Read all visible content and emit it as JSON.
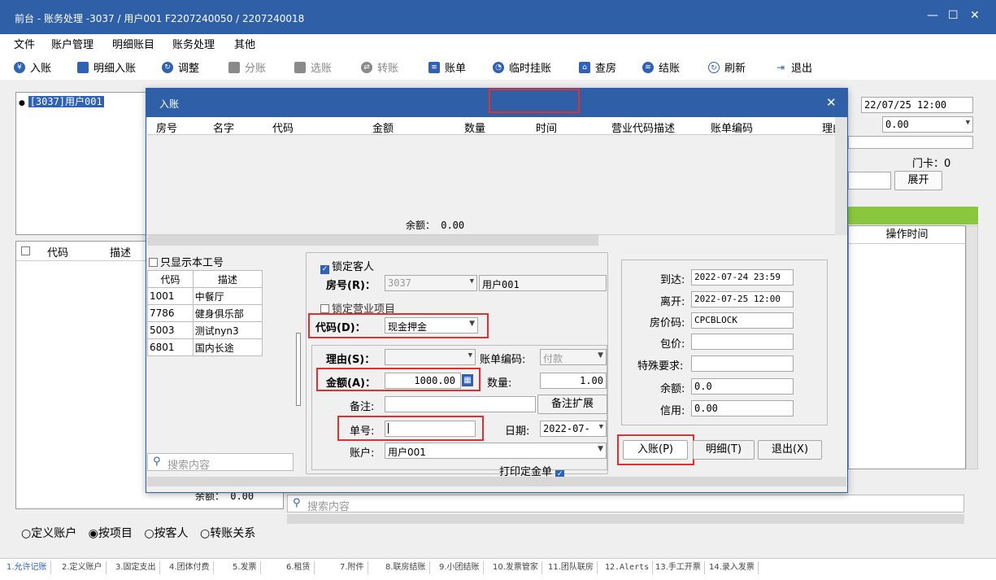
{
  "window": {
    "title": "前台 - 账务处理 -3037 / 用户001 F2207240050 / 2207240018",
    "controls": [
      "—",
      "☐",
      "✕"
    ]
  },
  "menu": [
    "文件",
    "账户管理",
    "明细账目",
    "账务处理",
    "其他"
  ],
  "toolbar": [
    {
      "label": "入账",
      "icon": "coin-icon",
      "disabled": false
    },
    {
      "label": "明细入账",
      "icon": "card-icon",
      "disabled": false
    },
    {
      "label": "调整",
      "icon": "adjust-icon",
      "disabled": false
    },
    {
      "label": "分账",
      "icon": "split-icon",
      "disabled": true
    },
    {
      "label": "选账",
      "icon": "select-icon",
      "disabled": true
    },
    {
      "label": "转账",
      "icon": "transfer-icon",
      "disabled": true
    },
    {
      "label": "账单",
      "icon": "bill-icon",
      "disabled": false
    },
    {
      "label": "临时挂账",
      "icon": "clock-icon",
      "disabled": false
    },
    {
      "label": "查房",
      "icon": "house-icon",
      "disabled": false
    },
    {
      "label": "结账",
      "icon": "stack-icon",
      "disabled": false
    },
    {
      "label": "刷新",
      "icon": "refresh-icon",
      "disabled": false
    },
    {
      "label": "退出",
      "icon": "exit-icon",
      "disabled": false
    }
  ],
  "background": {
    "tree_item": "[3037]用户001",
    "date_value": "22/07/25 12:00",
    "amount_value": "0.00",
    "door_card": "门卡：0",
    "expand_button": "展开",
    "op_time_header": "操作时间",
    "left_grid_headers": [
      "代码",
      "描述"
    ],
    "balance": "余额： 0.00",
    "radios": [
      "定义账户",
      "按项目",
      "按客人",
      "转账关系"
    ],
    "radio_selected": 1,
    "search_placeholder": "搜索内容"
  },
  "dialog": {
    "title": "入账",
    "grid_headers": [
      "房号",
      "名字",
      "代码",
      "金额",
      "数量",
      "时间",
      "营业代码描述",
      "账单编码",
      "理由"
    ],
    "balance": "余额： 0.00",
    "only_my_code": "只显示本工号",
    "code_headers": [
      "代码",
      "描述"
    ],
    "codes": [
      {
        "code": "1001",
        "desc": "中餐厅"
      },
      {
        "code": "7786",
        "desc": "健身俱乐部"
      },
      {
        "code": "5003",
        "desc": "测试nyn3"
      },
      {
        "code": "6801",
        "desc": "国内长途"
      }
    ],
    "search_placeholder": "搜索内容",
    "lock_guest": "锁定客人",
    "room_label": "房号(R)：",
    "room_value": "3037",
    "guest_name": "用户001",
    "lock_item": "锁定营业项目",
    "code_label": "代码(D)：",
    "code_value": "现金押金",
    "reason_label": "理由(S)：",
    "bill_code_label": "账单编码:",
    "bill_code_value": "付款",
    "amount_label": "金额(A)：",
    "amount_value": "1000.00",
    "qty_label": "数量:",
    "qty_value": "1.00",
    "note_label": "备注:",
    "note_ext_button": "备注扩展",
    "slip_label": "单号:",
    "date_label": "日期:",
    "date_value": "2022-07-",
    "account_label": "账户:",
    "account_value": "用户001",
    "print_deposit": "打印定金单",
    "info": {
      "arrive_label": "到达:",
      "arrive_value": "2022-07-24 23:59",
      "leave_label": "离开:",
      "leave_value": "2022-07-25 12:00",
      "rate_code_label": "房价码:",
      "rate_code_value": "CPCBLOCK",
      "package_label": "包价:",
      "package_value": "",
      "special_label": "特殊要求:",
      "special_value": "",
      "balance_label": "余额:",
      "balance_value": "0.0",
      "credit_label": "信用:",
      "credit_value": "0.00"
    },
    "post_button": "入账(P)",
    "detail_button": "明细(T)",
    "exit_button": "退出(X)"
  },
  "status_tabs": [
    "1.允许记账",
    "2.定义账户",
    "3.固定支出",
    "4.团体付费",
    "5.发票",
    "6.租赁",
    "7.附件",
    "8.联房结账",
    "9.小团结账",
    "10.发票管家",
    "11.团队联房",
    "12.Alerts",
    "13.手工开票",
    "14.录入发票"
  ],
  "colors": {
    "titlebar": "#2f5fa6",
    "highlight": "#e0302f",
    "green_bar": "#8bc63f"
  }
}
